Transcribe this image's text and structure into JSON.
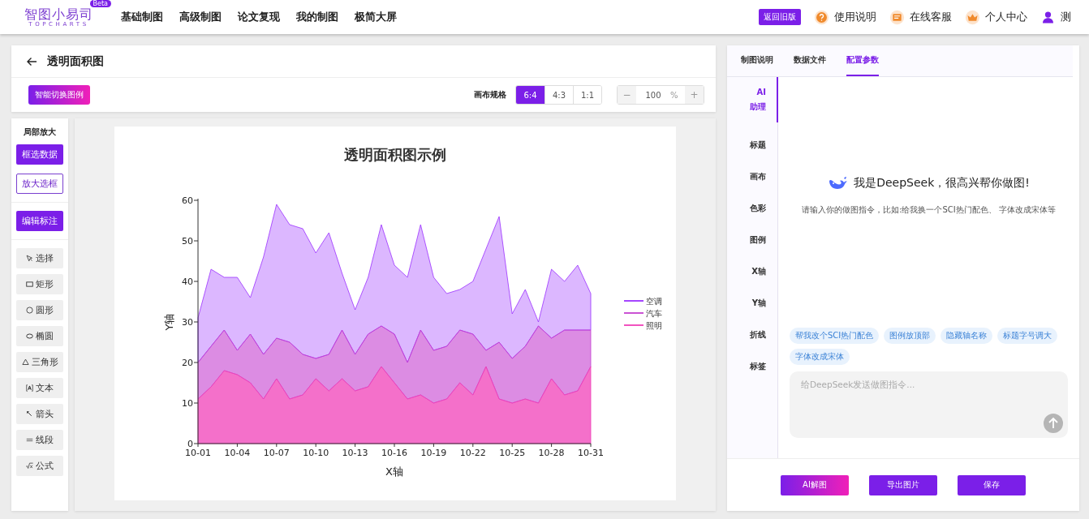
{
  "nav": {
    "logo": "智图小易司",
    "logo_sub": "TOPCHARTS",
    "badge": "Beta",
    "menu": [
      {
        "label": "基础制图"
      },
      {
        "label": "高级制图"
      },
      {
        "label": "论文复现"
      },
      {
        "label": "我的制图"
      },
      {
        "label": "极简大屏"
      }
    ],
    "old_version": "返回旧版",
    "links": [
      {
        "kind": "help",
        "label": "使用说明"
      },
      {
        "kind": "service",
        "label": "在线客服"
      },
      {
        "kind": "crown",
        "label": "个人中心"
      },
      {
        "kind": "user",
        "label": "测"
      }
    ]
  },
  "page": {
    "title": "透明面积图"
  },
  "toolbar": {
    "smart_button": "智能切换图例",
    "canvas_label": "画布规格",
    "ratios": [
      {
        "label": "6:4",
        "selected": true
      },
      {
        "label": "4:3",
        "selected": false
      },
      {
        "label": "1:1",
        "selected": false
      }
    ],
    "zoom": {
      "minus": "−",
      "value": "100",
      "unit": "%",
      "plus": "+"
    }
  },
  "tools": {
    "zoom_title": "局部放大",
    "select_data": "框选数据",
    "zoom_box": "放大选框",
    "edit_annot": "编辑标注",
    "items": [
      {
        "kind": "select",
        "label": "选择"
      },
      {
        "kind": "rect",
        "label": "矩形"
      },
      {
        "kind": "circle",
        "label": "圆形"
      },
      {
        "kind": "ellipse",
        "label": "椭圆"
      },
      {
        "kind": "triangle",
        "label": "三角形"
      },
      {
        "kind": "text",
        "label": "文本"
      },
      {
        "kind": "arrow",
        "label": "箭头"
      },
      {
        "kind": "line",
        "label": "线段"
      },
      {
        "kind": "formula",
        "label": "公式"
      }
    ]
  },
  "chart": {
    "chart_data": {
      "type": "area",
      "title": "透明面积图示例",
      "xlabel": "X轴",
      "ylabel": "Y轴",
      "stacked": true,
      "categories": [
        "10-01",
        null,
        null,
        "10-04",
        null,
        null,
        "10-07",
        null,
        null,
        "10-10",
        null,
        null,
        "10-13",
        null,
        null,
        "10-16",
        null,
        null,
        "10-19",
        null,
        null,
        "10-22",
        null,
        null,
        "10-25",
        null,
        null,
        "10-28",
        null,
        null,
        "10-31"
      ],
      "legend": true,
      "series": [
        {
          "name": "空调",
          "color": "#9b30ff",
          "values": [
            11,
            19,
            13,
            18,
            9,
            24,
            33,
            29,
            31,
            26,
            30,
            14,
            11,
            14,
            25,
            17,
            21,
            26,
            18,
            13,
            10,
            13,
            25,
            31,
            11,
            14,
            1,
            17,
            12,
            16,
            9
          ]
        },
        {
          "name": "汽车",
          "color": "#c43fd0",
          "values": [
            9,
            10,
            10,
            6,
            12,
            11,
            10,
            14,
            10,
            5,
            9,
            12,
            9,
            13,
            10,
            12,
            9,
            16,
            13,
            13,
            13,
            15,
            4,
            14,
            11,
            13,
            19,
            10,
            16,
            15,
            9
          ]
        },
        {
          "name": "照明",
          "color": "#f040b8",
          "values": [
            11,
            14,
            18,
            17,
            15,
            11,
            16,
            11,
            12,
            16,
            13,
            16,
            13,
            14,
            19,
            15,
            11,
            12,
            10,
            11,
            15,
            12,
            19,
            11,
            10,
            11,
            10,
            16,
            12,
            13,
            19
          ]
        }
      ],
      "ylim": [
        0,
        60
      ],
      "yticks": [
        0,
        10,
        20,
        30,
        40,
        50,
        60
      ]
    }
  },
  "panel": {
    "tabs": [
      {
        "label": "制图说明",
        "selected": false
      },
      {
        "label": "数据文件",
        "selected": false
      },
      {
        "label": "配置参数",
        "selected": true
      }
    ],
    "side": [
      {
        "label": "AI 助理",
        "selected": true
      },
      {
        "label": "标题",
        "selected": false
      },
      {
        "label": "画布",
        "selected": false
      },
      {
        "label": "色彩",
        "selected": false
      },
      {
        "label": "图例",
        "selected": false
      },
      {
        "label": "X轴",
        "selected": false
      },
      {
        "label": "Y轴",
        "selected": false
      },
      {
        "label": "折线",
        "selected": false
      },
      {
        "label": "标签",
        "selected": false
      }
    ],
    "greeting": "我是DeepSeek，很高兴帮你做图!",
    "hint": "请输入你的做图指令，比如:给我换一个SCI热门配色、 字体改成宋体等",
    "suggestions": [
      "帮我改个SCI热门配色",
      "图例放顶部",
      "隐藏轴名称",
      "标题字号调大",
      "字体改成宋体"
    ],
    "input_placeholder": "给DeepSeek发送做图指令...",
    "buttons": [
      {
        "kind": "gradient",
        "label": "AI解图"
      },
      {
        "kind": "solid",
        "label": "导出图片"
      },
      {
        "kind": "solid",
        "label": "保存"
      }
    ]
  }
}
